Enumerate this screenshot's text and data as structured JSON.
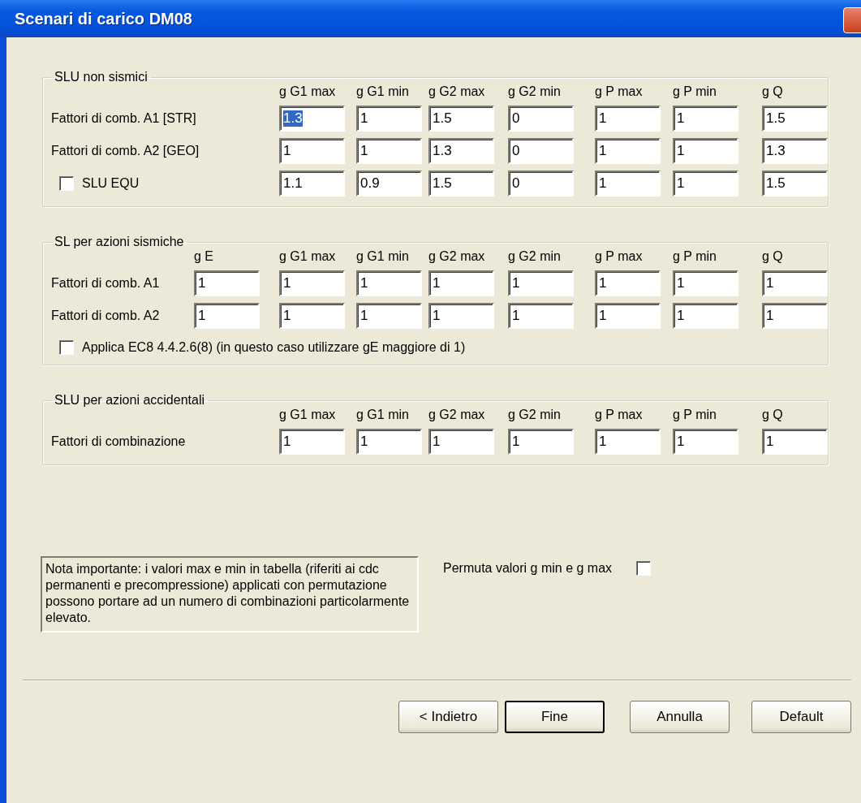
{
  "window": {
    "title": "Scenari di carico DM08"
  },
  "sections": [
    {
      "title": "SLU non sismici",
      "headers": [
        "g G1 max",
        "g G1 min",
        "g G2 max",
        "g G2 min",
        "g P max",
        "g P min",
        "g Q"
      ],
      "rows": [
        {
          "kind": "label",
          "label": "Fattori di comb. A1  [STR]",
          "values": [
            "1.3",
            "1",
            "1.5",
            "0",
            "1",
            "1",
            "1.5"
          ],
          "selected_values": [
            true,
            false,
            false,
            false,
            false,
            false,
            false
          ]
        },
        {
          "kind": "label",
          "label": "Fattori di comb. A2  [GEO]",
          "values": [
            "1",
            "1",
            "1.3",
            "0",
            "1",
            "1",
            "1.3"
          ]
        },
        {
          "kind": "checkbox",
          "label": "SLU EQU",
          "checked": false,
          "values": [
            "1.1",
            "0.9",
            "1.5",
            "0",
            "1",
            "1",
            "1.5"
          ]
        }
      ]
    },
    {
      "title": "SL per azioni sismiche",
      "headers": [
        "g E",
        "g G1 max",
        "g G1 min",
        "g G2 max",
        "g G2 min",
        "g P max",
        "g P min",
        "g Q"
      ],
      "rows": [
        {
          "kind": "label",
          "label": "Fattori di comb. A1",
          "values": [
            "1",
            "1",
            "1",
            "1",
            "1",
            "1",
            "1",
            "1"
          ]
        },
        {
          "kind": "label",
          "label": "Fattori di comb. A2",
          "values": [
            "1",
            "1",
            "1",
            "1",
            "1",
            "1",
            "1",
            "1"
          ]
        }
      ],
      "option": {
        "label": "Applica EC8 4.4.2.6(8)  (in questo caso utilizzare gE maggiore di 1)",
        "checked": false
      }
    },
    {
      "title": "SLU per azioni accidentali",
      "headers": [
        "g G1 max",
        "g G1 min",
        "g G2 max",
        "g G2 min",
        "g P max",
        "g P min",
        "g Q"
      ],
      "rows": [
        {
          "kind": "label",
          "label": "Fattori di combinazione",
          "values": [
            "1",
            "1",
            "1",
            "1",
            "1",
            "1",
            "1"
          ]
        }
      ]
    }
  ],
  "note": "Nota importante: i valori max e min in tabella (riferiti ai cdc permanenti e precompressione) applicati con permutazione possono portare ad un numero di combinazioni particolarmente elevato.",
  "permute": {
    "label": "Permuta valori g min e g max",
    "checked": false
  },
  "buttons": [
    {
      "label": "< Indietro",
      "default": false
    },
    {
      "label": "Fine",
      "default": true
    },
    {
      "label": "Annulla",
      "default": false
    },
    {
      "label": "Default",
      "default": false
    }
  ]
}
